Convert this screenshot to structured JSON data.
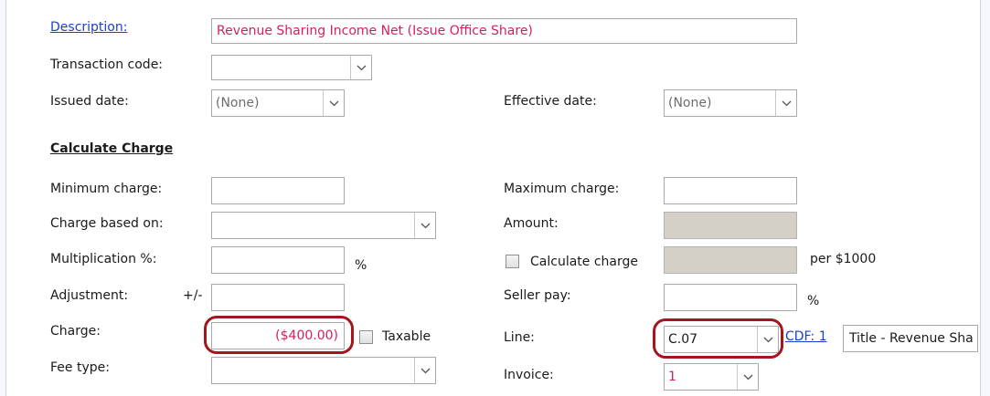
{
  "form": {
    "description": {
      "label": "Description:",
      "value": "Revenue Sharing Income Net (Issue Office Share)",
      "value_color": "#d6205a"
    },
    "transaction_code": {
      "label": "Transaction code:",
      "value": ""
    },
    "issued_date": {
      "label": "Issued date:",
      "value": "(None)"
    },
    "effective_date": {
      "label": "Effective date:",
      "value": "(None)"
    },
    "section_title": "Calculate Charge",
    "minimum_charge": {
      "label": "Minimum charge:",
      "value": ""
    },
    "maximum_charge": {
      "label": "Maximum charge:",
      "value": ""
    },
    "charge_based_on": {
      "label": "Charge based on:",
      "value": ""
    },
    "amount": {
      "label": "Amount:",
      "value": ""
    },
    "multiplication": {
      "label": "Multiplication %:",
      "value": "",
      "unit": "%"
    },
    "calculate_charge": {
      "label": "Calculate charge",
      "checked": false,
      "value": "",
      "unit": "per $1000"
    },
    "adjustment": {
      "label": "Adjustment:",
      "sign": "+/-",
      "value": ""
    },
    "seller_pay": {
      "label": "Seller pay:",
      "value": "",
      "unit": "%"
    },
    "charge": {
      "label": "Charge:",
      "value": "($400.00)",
      "value_color": "#d6205a"
    },
    "taxable": {
      "label": "Taxable",
      "checked": false
    },
    "line": {
      "label": "Line:",
      "value": "C.07",
      "cdf_link": "CDF: 1",
      "title_value": "Title - Revenue Sha"
    },
    "fee_type": {
      "label": "Fee type:",
      "value": ""
    },
    "invoice": {
      "label": "Invoice:",
      "value": "1",
      "value_color": "#d6205a"
    }
  },
  "colors": {
    "highlight_ring": "#a3161d",
    "link": "#1a3fd1",
    "disabled_field": "#d4d0c8"
  }
}
